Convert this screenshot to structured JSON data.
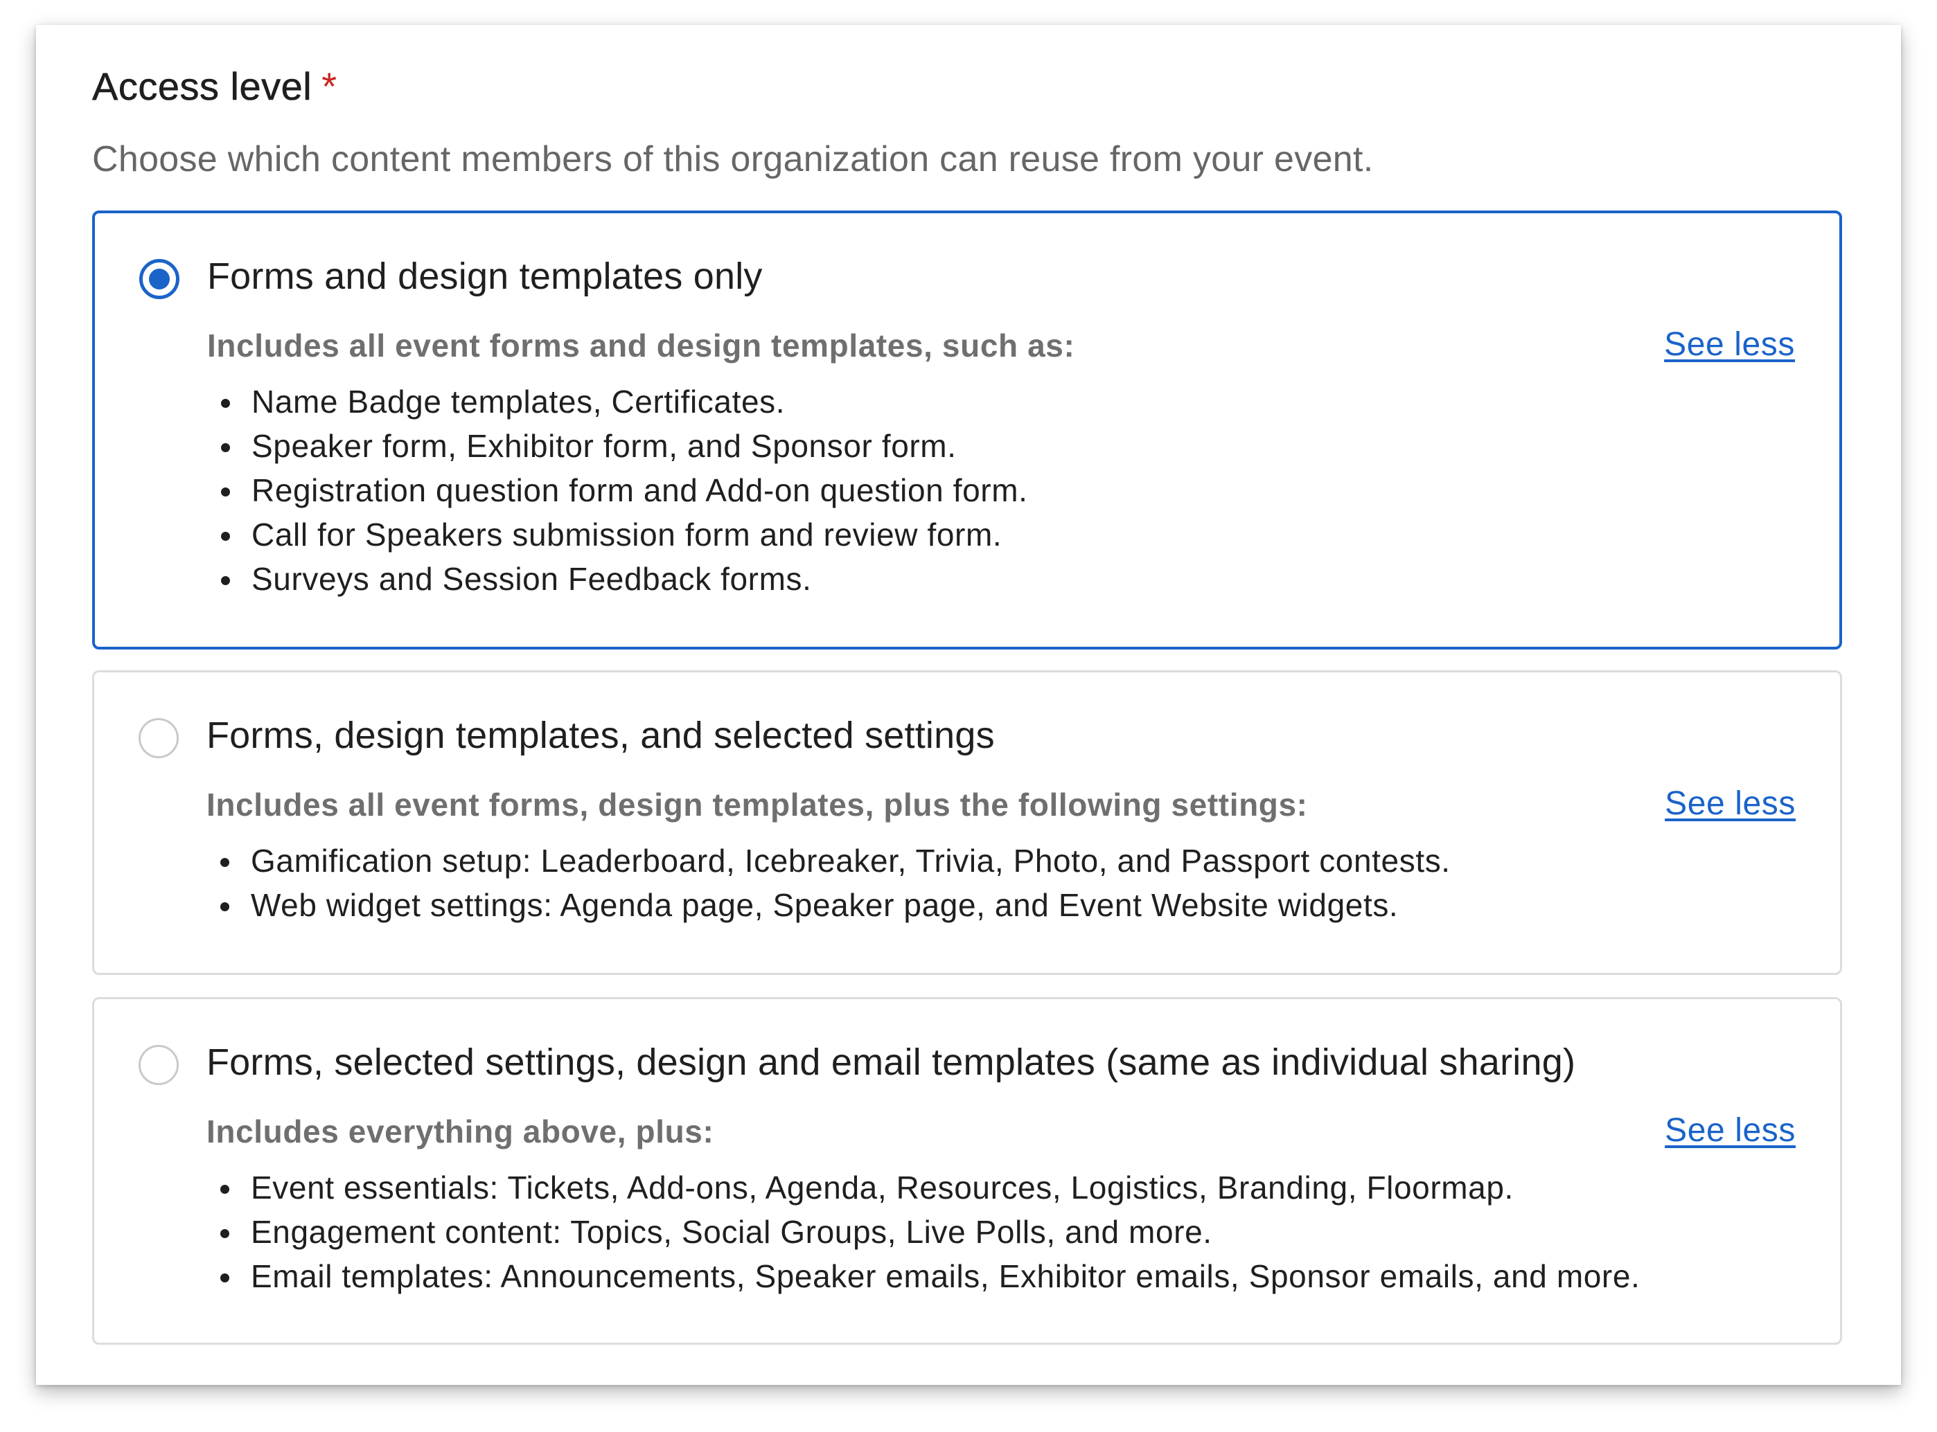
{
  "header": {
    "title": "Access level",
    "required_marker": "*",
    "subtitle": "Choose which content members of this organization can reuse from your event."
  },
  "options": [
    {
      "title": "Forms and design templates only",
      "selected": true,
      "description": "Includes all event forms and design templates, such as:",
      "toggle_label": "See less",
      "items": [
        "Name Badge templates, Certificates.",
        "Speaker form, Exhibitor form, and Sponsor form.",
        "Registration question form and Add-on question form.",
        "Call for Speakers submission form and review form.",
        "Surveys and Session Feedback forms."
      ]
    },
    {
      "title": "Forms, design templates, and selected settings",
      "selected": false,
      "description": "Includes all event forms, design templates, plus the following settings:",
      "toggle_label": "See less",
      "items": [
        "Gamification setup: Leaderboard, Icebreaker, Trivia, Photo, and Passport contests.",
        "Web widget settings: Agenda page, Speaker page, and Event Website widgets."
      ]
    },
    {
      "title": "Forms, selected settings, design and email templates (same as individual sharing)",
      "selected": false,
      "description": "Includes everything above, plus:",
      "toggle_label": "See less",
      "items": [
        "Event essentials: Tickets, Add-ons, Agenda, Resources, Logistics, Branding, Floormap.",
        "Engagement content: Topics, Social Groups, Live Polls, and more.",
        "Email templates: Announcements, Speaker emails, Exhibitor emails, Sponsor emails, and more."
      ]
    }
  ],
  "colors": {
    "accent": "#1a63c9",
    "required": "#c8261e",
    "border": "#dcdcdc",
    "muted_text": "#6f6f6f"
  }
}
